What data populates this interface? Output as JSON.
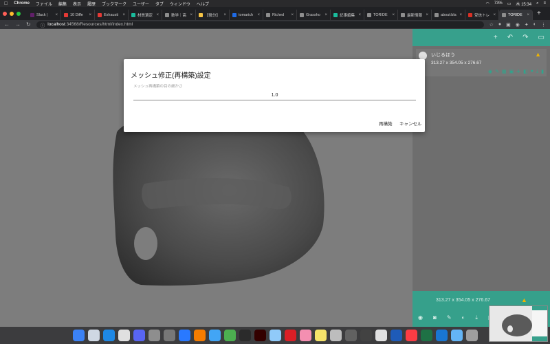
{
  "menubar": {
    "apple_icon": "apple-icon",
    "app_name": "Chrome",
    "items": [
      "ファイル",
      "編集",
      "表示",
      "履歴",
      "ブックマーク",
      "ユーザー",
      "タブ",
      "ウィンドウ",
      "ヘルプ"
    ],
    "battery": "73%",
    "clock": "木 15:34"
  },
  "tabs": [
    {
      "title": "Slack |",
      "color": "#611f69"
    },
    {
      "title": "10 Diffe",
      "color": "#e53935"
    },
    {
      "title": "Exhausti",
      "color": "#e53935"
    },
    {
      "title": "材質選定",
      "color": "#1abc9c"
    },
    {
      "title": "数学｜高",
      "color": "#8e8e8e"
    },
    {
      "title": "【微分】",
      "color": "#f6c445"
    },
    {
      "title": "tomarich",
      "color": "#1e6be6"
    },
    {
      "title": "Riched",
      "color": "#8e8e8e"
    },
    {
      "title": "Grassho",
      "color": "#8e8e8e"
    },
    {
      "title": "記事編集",
      "color": "#1abc9c"
    },
    {
      "title": "TORIDE",
      "color": "#8e8e8e"
    },
    {
      "title": "最新情報",
      "color": "#8e8e8e"
    },
    {
      "title": "about:bla",
      "color": "#8e8e8e"
    },
    {
      "title": "受信トレ",
      "color": "#d93025"
    },
    {
      "title": "TORIDE",
      "color": "#8e8e8e",
      "active": true
    }
  ],
  "address": {
    "host": "localhost",
    "path": ":34568/Resources/html/index.html"
  },
  "panel": {
    "item_name": "いじるほう",
    "item_dims": "313.27 x 354.05 x 276.67",
    "footer_dims": "313.27 x 354.05 x 276.67"
  },
  "dialog": {
    "title": "メッシュ修正(再構築)設定",
    "field_label": "メッシュ再構築の目の細かさ",
    "field_value": "1.0",
    "rebuild_label": "再構築",
    "cancel_label": "キャンセル"
  },
  "dock": {
    "apps": [
      {
        "name": "finder-icon",
        "color": "#3b82f6"
      },
      {
        "name": "safari-icon",
        "color": "#cfd8e3"
      },
      {
        "name": "vscode-icon",
        "color": "#1e88e5"
      },
      {
        "name": "chrome-icon",
        "color": "#e0e0e0"
      },
      {
        "name": "discord-icon",
        "color": "#5865f2"
      },
      {
        "name": "app-icon",
        "color": "#8e8e8e"
      },
      {
        "name": "app-icon",
        "color": "#777777"
      },
      {
        "name": "app-icon",
        "color": "#2979ff"
      },
      {
        "name": "fusion-icon",
        "color": "#f57c00"
      },
      {
        "name": "c-icon",
        "color": "#42a5f5"
      },
      {
        "name": "app-icon",
        "color": "#4caf50"
      },
      {
        "name": "pycharm-icon",
        "color": "#2b2b2b"
      },
      {
        "name": "illustrator-icon",
        "color": "#330000"
      },
      {
        "name": "preview-icon",
        "color": "#90caf9"
      },
      {
        "name": "creative-cloud-icon",
        "color": "#da1f26"
      },
      {
        "name": "photos-icon",
        "color": "#f48fb1"
      },
      {
        "name": "notes-icon",
        "color": "#f5e36a"
      },
      {
        "name": "app-icon",
        "color": "#bdbdbd"
      },
      {
        "name": "app-icon",
        "color": "#616161"
      },
      {
        "name": "app-icon",
        "color": "#424242"
      },
      {
        "name": "chrome-icon",
        "color": "#e0e0e0"
      },
      {
        "name": "word-icon",
        "color": "#1e5bb8"
      },
      {
        "name": "music-icon",
        "color": "#fc3c44"
      },
      {
        "name": "excel-icon",
        "color": "#1e7145"
      },
      {
        "name": "windows-icon",
        "color": "#1976d2"
      },
      {
        "name": "downloads-icon",
        "color": "#64b5f6"
      },
      {
        "name": "trash-icon",
        "color": "#9e9e9e"
      }
    ]
  }
}
